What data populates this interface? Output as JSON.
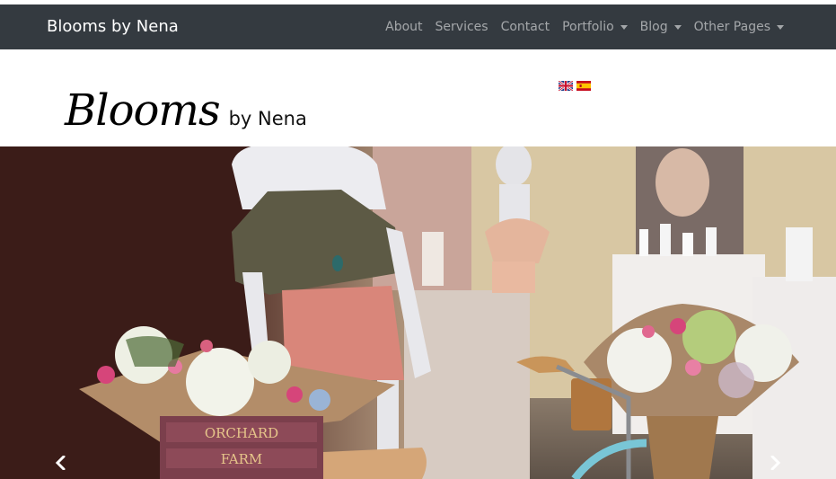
{
  "navbar": {
    "brand": "Blooms by Nena",
    "items": [
      {
        "label": "About",
        "dropdown": false
      },
      {
        "label": "Services",
        "dropdown": false
      },
      {
        "label": "Contact",
        "dropdown": false
      },
      {
        "label": "Portfolio",
        "dropdown": true
      },
      {
        "label": "Blog",
        "dropdown": true
      },
      {
        "label": "Other Pages",
        "dropdown": true
      }
    ]
  },
  "logo": {
    "main": "Blooms",
    "sub": "by Nena"
  },
  "languages": [
    "en-flag-icon",
    "es-flag-icon"
  ],
  "carousel": {
    "crate_text_line1": "ORCHARD",
    "crate_text_line2": "FARM",
    "prev_icon": "chevron-left-icon",
    "next_icon": "chevron-right-icon"
  },
  "colors": {
    "navbar_bg": "#343a40",
    "nav_text": "rgba(255,255,255,0.55)",
    "brand_text": "#ffffff"
  }
}
